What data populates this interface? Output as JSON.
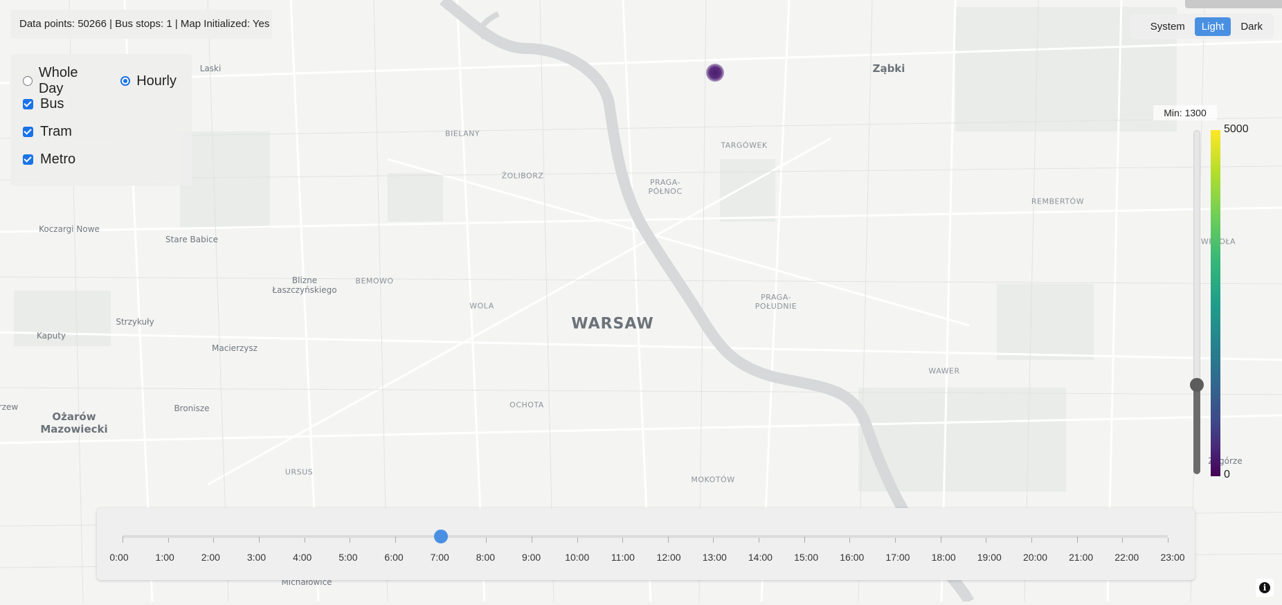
{
  "info_bar": {
    "text": "Data points: 50266 | Bus stops: 1 | Map Initialized: Yes"
  },
  "filters": {
    "mode_options": [
      {
        "label": "Whole Day",
        "checked": false
      },
      {
        "label": "Hourly",
        "checked": true
      }
    ],
    "transport_types": [
      {
        "label": "Bus",
        "checked": true
      },
      {
        "label": "Tram",
        "checked": true
      },
      {
        "label": "Metro",
        "checked": true
      }
    ]
  },
  "theme": {
    "options": [
      "System",
      "Light",
      "Dark"
    ],
    "selected": "Light"
  },
  "legend": {
    "min_label": "Min: 1300",
    "max_value": "5000",
    "zero_value": "0",
    "min_threshold": 1300,
    "max": 5000,
    "colormap": "viridis"
  },
  "time_slider": {
    "ticks": [
      "0:00",
      "1:00",
      "2:00",
      "3:00",
      "4:00",
      "5:00",
      "6:00",
      "7:00",
      "8:00",
      "9:00",
      "10:00",
      "11:00",
      "12:00",
      "13:00",
      "14:00",
      "15:00",
      "16:00",
      "17:00",
      "18:00",
      "19:00",
      "20:00",
      "21:00",
      "22:00",
      "23:00"
    ],
    "selected_hour": 7
  },
  "map": {
    "labels": [
      {
        "text": "Laski",
        "kind": "town"
      },
      {
        "text": "Ząbki",
        "kind": "town-big"
      },
      {
        "text": "BIELANY",
        "kind": "district"
      },
      {
        "text": "TARGÓWEK",
        "kind": "district"
      },
      {
        "text": "ŻOLIBORZ",
        "kind": "district"
      },
      {
        "text": "PRAGA-\nPÓŁNOC",
        "kind": "district"
      },
      {
        "text": "REMBERTÓW",
        "kind": "district"
      },
      {
        "text": "Koczargi Nowe",
        "kind": "town"
      },
      {
        "text": "Stare Babice",
        "kind": "town"
      },
      {
        "text": "WESOŁA",
        "kind": "district"
      },
      {
        "text": "Blizne\nŁaszczyńskiego",
        "kind": "town"
      },
      {
        "text": "BEMOWO",
        "kind": "district"
      },
      {
        "text": "WOLA",
        "kind": "district"
      },
      {
        "text": "PRAGA-\nPOŁUDNIE",
        "kind": "district"
      },
      {
        "text": "WARSAW",
        "kind": "city"
      },
      {
        "text": "Strzykuły",
        "kind": "town"
      },
      {
        "text": "Kaputy",
        "kind": "town"
      },
      {
        "text": "Macierzysz",
        "kind": "town"
      },
      {
        "text": "WAWER",
        "kind": "district"
      },
      {
        "text": "Ożarów\nMazowiecki",
        "kind": "town-big"
      },
      {
        "text": "Bronisze",
        "kind": "town"
      },
      {
        "text": "OCHOTA",
        "kind": "district"
      },
      {
        "text": "URSUS",
        "kind": "district"
      },
      {
        "text": "MOKOTÓW",
        "kind": "district"
      },
      {
        "text": "Michałowice",
        "kind": "town"
      },
      {
        "text": "rzew",
        "kind": "town"
      },
      {
        "text": "Zagórze",
        "kind": "town"
      }
    ]
  },
  "info_button": {
    "icon": "info-icon"
  }
}
